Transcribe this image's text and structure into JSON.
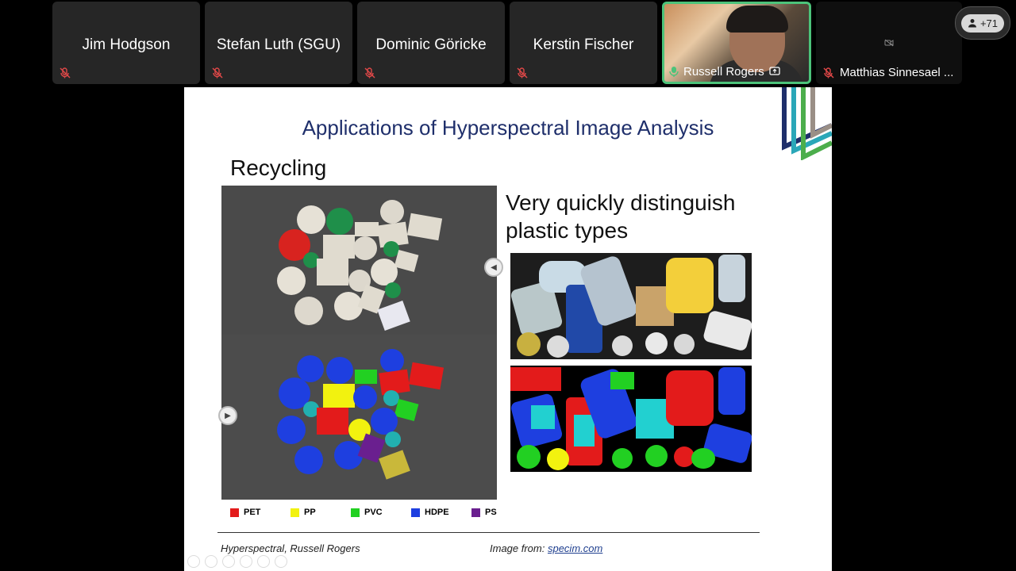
{
  "participants": [
    {
      "name": "Jim Hodgson"
    },
    {
      "name": "Stefan Luth (SGU)"
    },
    {
      "name": "Dominic Göricke"
    },
    {
      "name": "Kerstin Fischer"
    }
  ],
  "active_speaker": {
    "name": "Russell Rogers"
  },
  "dark_participant": {
    "name": "Matthias Sinnesael ..."
  },
  "overflow": {
    "count": "+71"
  },
  "slide": {
    "title": "Applications of Hyperspectral Image Analysis",
    "subtitle": "Recycling",
    "caption": "Very quickly distinguish plastic types",
    "legend": [
      {
        "label": "PET",
        "color": "#e31b1b"
      },
      {
        "label": "PP",
        "color": "#f2f20f"
      },
      {
        "label": "PVC",
        "color": "#22d022"
      },
      {
        "label": "HDPE",
        "color": "#1e3fe0"
      },
      {
        "label": "PS",
        "color": "#6a1f8f"
      }
    ],
    "footer_left": "Hyperspectral, Russell Rogers",
    "footer_right_prefix": "Image from: ",
    "footer_link": "specim.com"
  },
  "colors": {
    "speaker_border": "#4cc37a",
    "title": "#1f2f6b"
  }
}
